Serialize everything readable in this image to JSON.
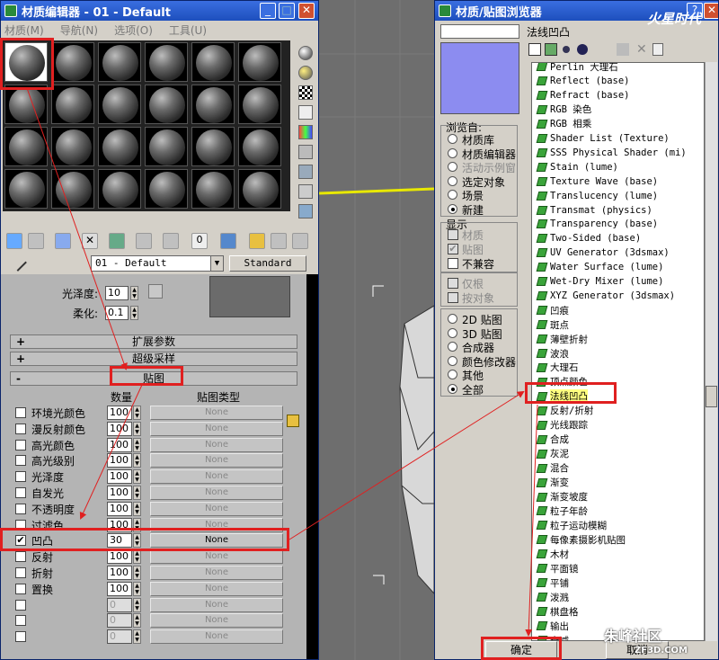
{
  "left_window": {
    "title": "材质编辑器 - 01 - Default",
    "menu": [
      "材质(M)",
      "导航(N)",
      "选项(O)",
      "工具(U)"
    ],
    "material_name": "01 - Default",
    "material_type": "Standard",
    "glossiness_label": "光泽度:",
    "glossiness_value": "10",
    "soften_label": "柔化:",
    "soften_value": "0.1",
    "rollouts": {
      "extended": "扩展参数",
      "supersampling": "超级采样",
      "maps": "贴图"
    },
    "columns": {
      "amount": "数量",
      "map_type": "贴图类型"
    },
    "map_rows": [
      {
        "label": "环境光颜色",
        "amount": "100",
        "map": "None",
        "checked": false
      },
      {
        "label": "漫反射颜色",
        "amount": "100",
        "map": "None",
        "checked": false
      },
      {
        "label": "高光颜色",
        "amount": "100",
        "map": "None",
        "checked": false
      },
      {
        "label": "高光级别",
        "amount": "100",
        "map": "None",
        "checked": false
      },
      {
        "label": "光泽度",
        "amount": "100",
        "map": "None",
        "checked": false
      },
      {
        "label": "自发光",
        "amount": "100",
        "map": "None",
        "checked": false
      },
      {
        "label": "不透明度",
        "amount": "100",
        "map": "None",
        "checked": false
      },
      {
        "label": "过滤色",
        "amount": "100",
        "map": "None",
        "checked": false
      },
      {
        "label": "凹凸",
        "amount": "30",
        "map": "None",
        "checked": true
      },
      {
        "label": "反射",
        "amount": "100",
        "map": "None",
        "checked": false
      },
      {
        "label": "折射",
        "amount": "100",
        "map": "None",
        "checked": false
      },
      {
        "label": "置换",
        "amount": "100",
        "map": "None",
        "checked": false
      },
      {
        "label": "",
        "amount": "0",
        "map": "None",
        "checked": false
      },
      {
        "label": "",
        "amount": "0",
        "map": "None",
        "checked": false
      },
      {
        "label": "",
        "amount": "0",
        "map": "None",
        "checked": false
      }
    ],
    "check_glyph": "✔"
  },
  "right_window": {
    "title": "材质/贴图浏览器",
    "current_map": "法线凹凸",
    "browse_from_label": "浏览自:",
    "browse_from": [
      {
        "label": "材质库",
        "on": false,
        "disabled": false
      },
      {
        "label": "材质编辑器",
        "on": false,
        "disabled": false
      },
      {
        "label": "活动示例窗",
        "on": false,
        "disabled": true
      },
      {
        "label": "选定对象",
        "on": false,
        "disabled": false
      },
      {
        "label": "场景",
        "on": false,
        "disabled": false
      },
      {
        "label": "新建",
        "on": true,
        "disabled": false
      }
    ],
    "show_label": "显示",
    "show_options": [
      {
        "label": "材质",
        "disabled": true,
        "checked": false
      },
      {
        "label": "贴图",
        "disabled": true,
        "checked": true
      },
      {
        "label": "不兼容",
        "disabled": false,
        "checked": false
      }
    ],
    "extra_options": [
      {
        "label": "仅根"
      },
      {
        "label": "按对象"
      }
    ],
    "categories": [
      {
        "label": "2D 贴图",
        "on": false
      },
      {
        "label": "3D 贴图",
        "on": false
      },
      {
        "label": "合成器",
        "on": false
      },
      {
        "label": "颜色修改器",
        "on": false
      },
      {
        "label": "其他",
        "on": false
      },
      {
        "label": "全部",
        "on": true
      }
    ],
    "map_list": [
      "Perlin 大理石",
      "Reflect (base)",
      "Refract (base)",
      "RGB 染色",
      "RGB 相乘",
      "Shader List (Texture)",
      "SSS Physical Shader (mi)",
      "Stain (lume)",
      "Texture Wave (base)",
      "Translucency (lume)",
      "Transmat (physics)",
      "Transparency (base)",
      "Two-Sided (base)",
      "UV Generator (3dsmax)",
      "Water Surface (lume)",
      "Wet-Dry Mixer (lume)",
      "XYZ Generator (3dsmax)",
      "凹痕",
      "斑点",
      "薄壁折射",
      "波浪",
      "大理石",
      "顶点颜色",
      "法线凹凸",
      "反射/折射",
      "光线跟踪",
      "合成",
      "灰泥",
      "混合",
      "渐变",
      "渐变坡度",
      "粒子年龄",
      "粒子运动模糊",
      "每像素摄影机贴图",
      "木材",
      "平面镜",
      "平铺",
      "泼溅",
      "棋盘格",
      "输出",
      "衰减"
    ],
    "highlight_index": 23,
    "ok": "确定",
    "cancel": "取消",
    "swatch_color": "#8c8cf0"
  },
  "watermarks": {
    "top": "火星时代",
    "bottom": "朱峰社区",
    "bottom_url": "ZF3D.COM"
  }
}
